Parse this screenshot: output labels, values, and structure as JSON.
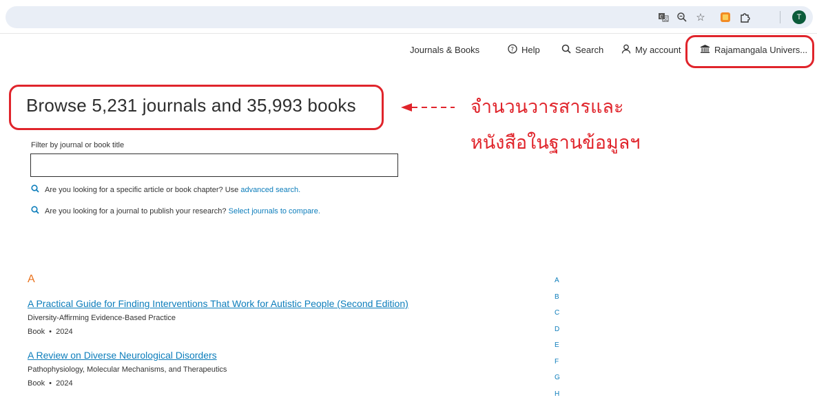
{
  "browser": {
    "translate_icon": "translate-icon",
    "zoom_icon": "zoom-icon",
    "bookmark_icon": "star-icon",
    "extension_icon": "extension-puzzle-icon",
    "profile_initial": "T"
  },
  "nav": {
    "journals_books": "Journals & Books",
    "help": "Help",
    "search": "Search",
    "my_account": "My account",
    "institution": "Rajamangala Univers..."
  },
  "page": {
    "heading": "Browse 5,231 journals and 35,993 books",
    "annotation_line1": "จำนวนวารสารและ",
    "annotation_line2": "หนังสือในฐานข้อมูลฯ",
    "filter_label": "Filter by journal or book title",
    "filter_value": "",
    "hint1_text": "Are you looking for a specific article or book chapter? Use",
    "hint1_link": "advanced search.",
    "hint2_text": "Are you looking for a journal to publish your research?",
    "hint2_link": "Select journals to compare."
  },
  "listing": {
    "section_letter": "A",
    "items": [
      {
        "title": "A Practical Guide for Finding Interventions That Work for Autistic People (Second Edition)",
        "subtitle": "Diversity-Affirming Evidence-Based Practice",
        "meta": "Book  •  2024"
      },
      {
        "title": "A Review on Diverse Neurological Disorders",
        "subtitle": "Pathophysiology, Molecular Mechanisms, and Therapeutics",
        "meta": "Book  •  2024"
      }
    ]
  },
  "az_index": [
    "A",
    "B",
    "C",
    "D",
    "E",
    "F",
    "G",
    "H"
  ],
  "colors": {
    "accent_link": "#0c7dbb",
    "section_letter": "#e9711c",
    "annotation_red": "#e0242b"
  }
}
